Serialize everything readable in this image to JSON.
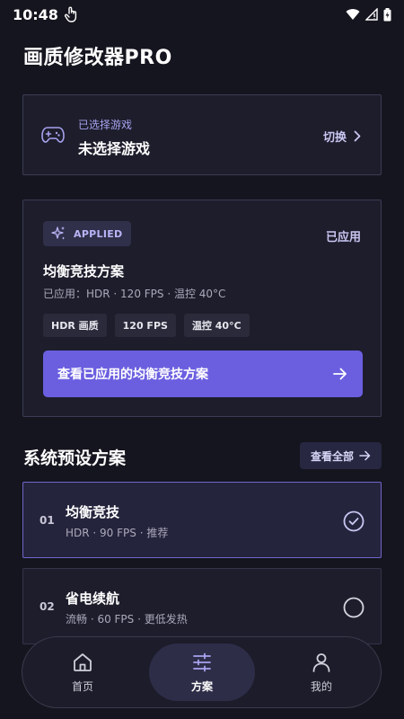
{
  "status_bar": {
    "time": "10:48"
  },
  "app": {
    "title": "画质修改器PRO"
  },
  "game_selector": {
    "caption": "已选择游戏",
    "current_game": "未选择游戏",
    "switch_label": "切换"
  },
  "applied_plan": {
    "badge": "APPLIED",
    "status": "已应用",
    "name": "均衡竞技方案",
    "detail": "已应用：HDR · 120 FPS · 温控 40°C",
    "tags": [
      "HDR 画质",
      "120 FPS",
      "温控 40°C"
    ],
    "view_button": "查看已应用的均衡竞技方案"
  },
  "presets": {
    "title": "系统预设方案",
    "view_all": "查看全部",
    "items": [
      {
        "index": "01",
        "name": "均衡竞技",
        "desc": "HDR · 90 FPS · 推荐",
        "selected": true
      },
      {
        "index": "02",
        "name": "省电续航",
        "desc": "流畅 · 60 FPS · 更低发热",
        "selected": false
      }
    ]
  },
  "bottom_nav": {
    "items": [
      {
        "label": "首页",
        "icon": "home-icon",
        "active": false
      },
      {
        "label": "方案",
        "icon": "sliders-icon",
        "active": true
      },
      {
        "label": "我的",
        "icon": "user-icon",
        "active": false
      }
    ]
  },
  "colors": {
    "background": "#15151f",
    "card": "#1d1d2c",
    "accent": "#6b5fe0",
    "accent_text": "#c9c6f2"
  }
}
